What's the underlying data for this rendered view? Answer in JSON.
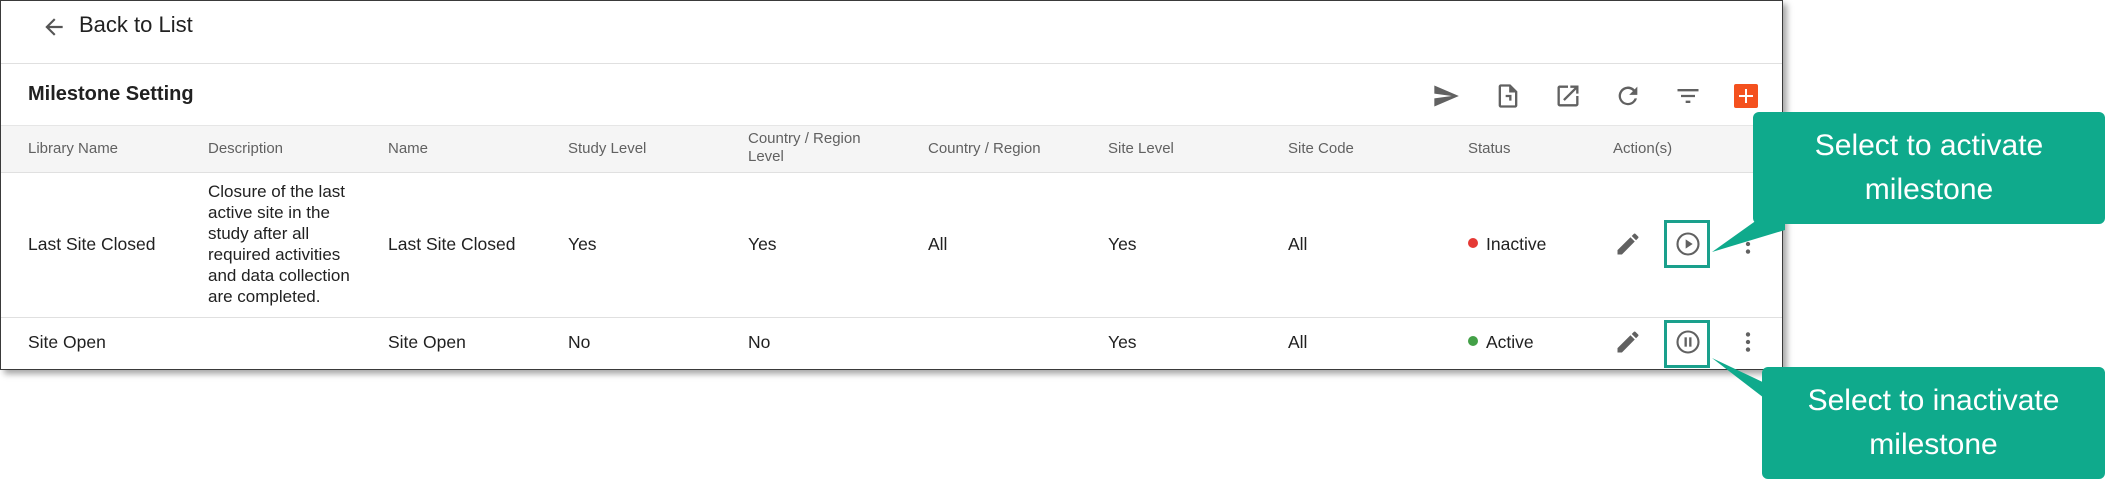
{
  "nav": {
    "back_label": "Back to List"
  },
  "page_title": "Milestone Setting",
  "colors": {
    "accent": "#f4511e",
    "inactive": "#e53935",
    "active": "#43a047",
    "callout": "#0faa8c"
  },
  "toolbar": [
    "send-icon",
    "export-file-icon",
    "open-external-icon",
    "refresh-icon",
    "filter-icon",
    "add-icon"
  ],
  "table": {
    "headers": {
      "library_name": "Library Name",
      "description": "Description",
      "name": "Name",
      "study_level": "Study Level",
      "country_region_level": "Country / Region Level",
      "country_region": "Country / Region",
      "site_level": "Site Level",
      "site_code": "Site Code",
      "status": "Status",
      "actions": "Action(s)"
    },
    "rows": [
      {
        "library_name": "Last Site Closed",
        "description": "Closure of the last active site in the study after all required activities and data collection are completed.",
        "name": "Last Site Closed",
        "study_level": "Yes",
        "country_region_level": "Yes",
        "country_region": "All",
        "site_level": "Yes",
        "site_code": "All",
        "status": "Inactive"
      },
      {
        "library_name": "Site Open",
        "description": "",
        "name": "Site Open",
        "study_level": "No",
        "country_region_level": "No",
        "country_region": "",
        "site_level": "Yes",
        "site_code": "All",
        "status": "Active"
      }
    ]
  },
  "callouts": {
    "activate": "Select to activate milestone",
    "inactivate": "Select to inactivate milestone"
  }
}
